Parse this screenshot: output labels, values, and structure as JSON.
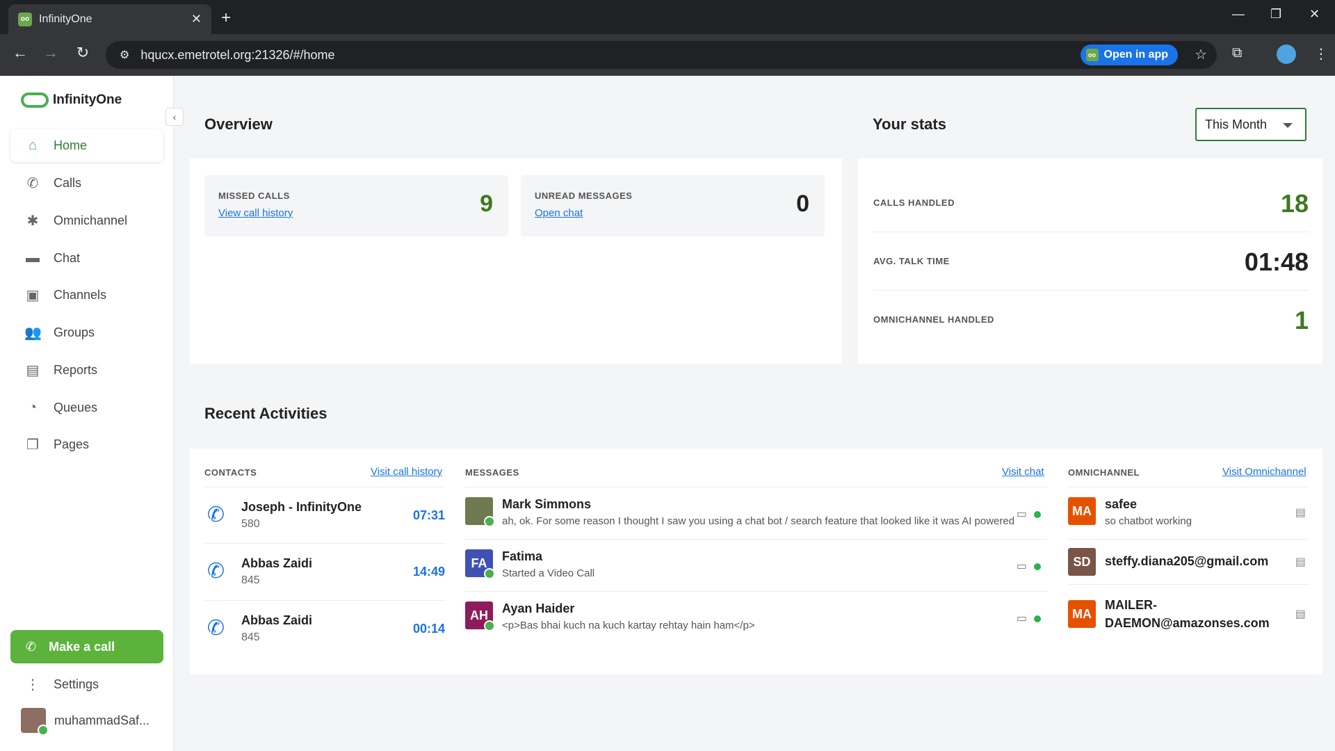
{
  "browser": {
    "tab_title": "InfinityOne",
    "favicon": "oo",
    "url": "hqucx.emetrotel.org:21326/#/home",
    "open_in_app": "Open in app"
  },
  "sidebar": {
    "brand": "InfinityOne",
    "items": [
      {
        "label": "Home",
        "icon": "home-icon"
      },
      {
        "label": "Calls",
        "icon": "phone-icon"
      },
      {
        "label": "Omnichannel",
        "icon": "hub-icon"
      },
      {
        "label": "Chat",
        "icon": "chat-icon"
      },
      {
        "label": "Channels",
        "icon": "channels-icon"
      },
      {
        "label": "Groups",
        "icon": "groups-icon"
      },
      {
        "label": "Reports",
        "icon": "reports-icon"
      },
      {
        "label": "Queues",
        "icon": "pie-icon"
      },
      {
        "label": "Pages",
        "icon": "pages-icon"
      }
    ],
    "make_call": "Make a call",
    "settings": "Settings",
    "user": "muhammadSaf..."
  },
  "overview": {
    "title": "Overview",
    "missed_calls": {
      "label": "MISSED CALLS",
      "link": "View call history",
      "value": "9"
    },
    "unread_messages": {
      "label": "UNREAD MESSAGES",
      "link": "Open chat",
      "value": "0"
    }
  },
  "stats": {
    "title": "Your stats",
    "period": "This Month",
    "rows": [
      {
        "label": "CALLS HANDLED",
        "value": "18"
      },
      {
        "label": "AVG. TALK TIME",
        "value": "01:48"
      },
      {
        "label": "OMNICHANNEL HANDLED",
        "value": "1"
      }
    ]
  },
  "recent": {
    "title": "Recent Activities",
    "contacts": {
      "heading": "CONTACTS",
      "link": "Visit call history",
      "items": [
        {
          "name": "Joseph - InfinityOne",
          "ext": "580",
          "duration": "07:31"
        },
        {
          "name": "Abbas Zaidi",
          "ext": "845",
          "duration": "14:49"
        },
        {
          "name": "Abbas Zaidi",
          "ext": "845",
          "duration": "00:14"
        }
      ]
    },
    "messages": {
      "heading": "MESSAGES",
      "link": "Visit chat",
      "items": [
        {
          "initials": "",
          "name": "Mark Simmons",
          "text": "ah, ok. For some reason I thought I saw you using a chat bot / search feature that looked like it was AI powered",
          "color": "#6d7a4f"
        },
        {
          "initials": "FA",
          "name": "Fatima",
          "text": "Started a Video Call",
          "color": "#3f51b5"
        },
        {
          "initials": "AH",
          "name": "Ayan Haider",
          "text": "<p>Bas bhai kuch na kuch kartay rehtay hain ham</p>",
          "color": "#8e1b5c"
        }
      ]
    },
    "omnichannel": {
      "heading": "OMNICHANNEL",
      "link": "Visit Omnichannel",
      "items": [
        {
          "initials": "MA",
          "name": "safee",
          "sub": "so chatbot working",
          "color": "#e65100"
        },
        {
          "initials": "SD",
          "name": "steffy.diana205@gmail.com",
          "sub": "",
          "color": "#795548"
        },
        {
          "initials": "MA",
          "name": "MAILER-DAEMON@amazonses.com",
          "sub": "",
          "color": "#e65100"
        }
      ]
    }
  },
  "colors": {
    "accent": "#4caf50",
    "link": "#1a73e8",
    "value_green": "#3d7a1f"
  }
}
